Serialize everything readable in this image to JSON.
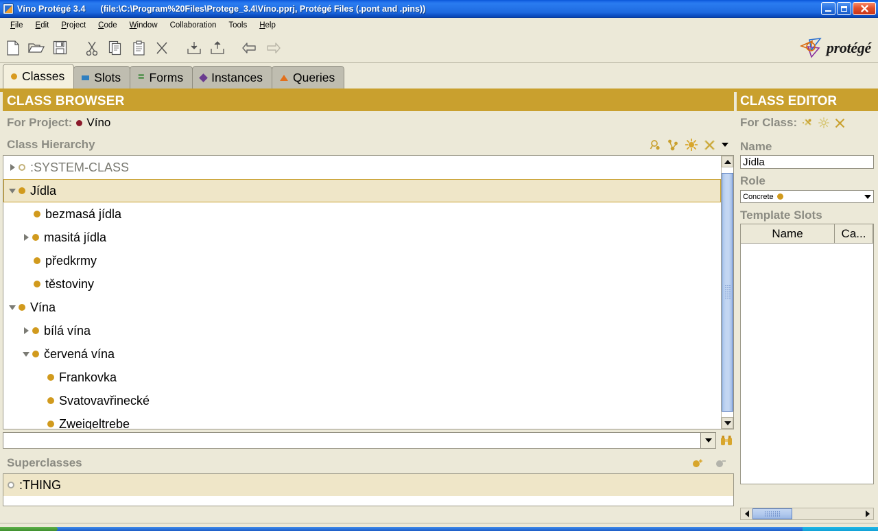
{
  "window": {
    "app_title": "Víno  Protégé 3.4",
    "file_info": "(file:\\C:\\Program%20Files\\Protege_3.4\\Víno.pprj, Protégé Files (.pont and .pins))",
    "minimize_label": "Minimize",
    "restore_label": "Restore",
    "close_label": "Close",
    "app_icon": "protege-window-icon"
  },
  "menubar": {
    "items": [
      {
        "label": "File",
        "mnemonic": "F"
      },
      {
        "label": "Edit",
        "mnemonic": "E"
      },
      {
        "label": "Project",
        "mnemonic": "P"
      },
      {
        "label": "Code",
        "mnemonic": "C"
      },
      {
        "label": "Window",
        "mnemonic": "W"
      },
      {
        "label": "Collaboration",
        "mnemonic": ""
      },
      {
        "label": "Tools",
        "mnemonic": ""
      },
      {
        "label": "Help",
        "mnemonic": "H"
      }
    ]
  },
  "toolbar": {
    "buttons": [
      {
        "name": "new-project-icon",
        "title": "New Project"
      },
      {
        "name": "open-project-icon",
        "title": "Open Project"
      },
      {
        "name": "save-project-icon",
        "title": "Save Project"
      },
      {
        "name": "cut-icon",
        "title": "Cut"
      },
      {
        "name": "copy-icon",
        "title": "Copy"
      },
      {
        "name": "paste-icon",
        "title": "Paste"
      },
      {
        "name": "delete-icon",
        "title": "Delete"
      },
      {
        "name": "archive-in-icon",
        "title": "Archive"
      },
      {
        "name": "archive-out-icon",
        "title": "Export"
      },
      {
        "name": "undo-icon",
        "title": "Undo"
      },
      {
        "name": "redo-icon",
        "title": "Redo"
      }
    ],
    "brand_text": "protégé"
  },
  "tabs": [
    {
      "label": "Classes",
      "icon": "orange-dot-icon",
      "active": true
    },
    {
      "label": "Slots",
      "icon": "blue-rect-icon",
      "active": false
    },
    {
      "label": "Forms",
      "icon": "green-equals-icon",
      "active": false
    },
    {
      "label": "Instances",
      "icon": "purple-diamond-icon",
      "active": false
    },
    {
      "label": "Queries",
      "icon": "orange-triangle-icon",
      "active": false
    }
  ],
  "class_browser": {
    "title": "CLASS BROWSER",
    "for_project_label": "For Project:",
    "project_name": "Víno",
    "hierarchy_label": "Class Hierarchy",
    "hierarchy_tools": [
      {
        "name": "find-class-icon"
      },
      {
        "name": "subclass-link-icon"
      },
      {
        "name": "create-class-icon"
      },
      {
        "name": "delete-class-icon"
      },
      {
        "name": "hierarchy-menu-chevron-icon"
      }
    ],
    "tree": [
      {
        "label": ":SYSTEM-CLASS",
        "indent": 0,
        "twisty": "right",
        "dot": "hollow",
        "system": true,
        "selected": false
      },
      {
        "label": "Jídla",
        "indent": 0,
        "twisty": "down",
        "dot": "filled",
        "system": false,
        "selected": true
      },
      {
        "label": "bezmasá jídla",
        "indent": 1,
        "twisty": "none",
        "dot": "filled",
        "system": false,
        "selected": false
      },
      {
        "label": "masitá jídla",
        "indent": 1,
        "twisty": "right",
        "dot": "filled",
        "system": false,
        "selected": false
      },
      {
        "label": "předkrmy",
        "indent": 1,
        "twisty": "none",
        "dot": "filled",
        "system": false,
        "selected": false
      },
      {
        "label": "těstoviny",
        "indent": 1,
        "twisty": "none",
        "dot": "filled",
        "system": false,
        "selected": false
      },
      {
        "label": "Vína",
        "indent": 0,
        "twisty": "down",
        "dot": "filled",
        "system": false,
        "selected": false
      },
      {
        "label": "bílá vína",
        "indent": 1,
        "twisty": "right",
        "dot": "filled",
        "system": false,
        "selected": false
      },
      {
        "label": "červená vína",
        "indent": 1,
        "twisty": "down",
        "dot": "filled",
        "system": false,
        "selected": false
      },
      {
        "label": "Frankovka",
        "indent": 2,
        "twisty": "none",
        "dot": "filled",
        "system": false,
        "selected": false
      },
      {
        "label": "Svatovavřinecké",
        "indent": 2,
        "twisty": "none",
        "dot": "filled",
        "system": false,
        "selected": false
      },
      {
        "label": "Zweigeltrebe",
        "indent": 2,
        "twisty": "none",
        "dot": "filled",
        "system": false,
        "selected": false
      }
    ],
    "filter_combo_value": "",
    "filter_find_icon": "binoculars-icon",
    "superclasses_label": "Superclasses",
    "superclasses_tools": [
      {
        "name": "add-superclass-icon"
      },
      {
        "name": "remove-superclass-icon"
      }
    ],
    "superclasses": [
      {
        "label": ":THING",
        "selected": true
      }
    ]
  },
  "class_editor": {
    "title": "CLASS EDITOR",
    "for_class_label": "For Class:",
    "header_tools": [
      {
        "name": "class-annotation-icon"
      },
      {
        "name": "class-create-icon"
      },
      {
        "name": "class-delete-icon"
      }
    ],
    "name_label": "Name",
    "name_value": "Jídla",
    "role_label": "Role",
    "role_value": "Concrete",
    "template_slots_label": "Template Slots",
    "slots_columns": [
      "Name",
      "Ca..."
    ],
    "slots_rows": []
  },
  "colors": {
    "accent_gold": "#c9a02e",
    "title_blue": "#1b6ae8",
    "panel_bg": "#ece9d8",
    "selection_cream": "#efe6c8",
    "node_dot": "#d19a1d"
  }
}
